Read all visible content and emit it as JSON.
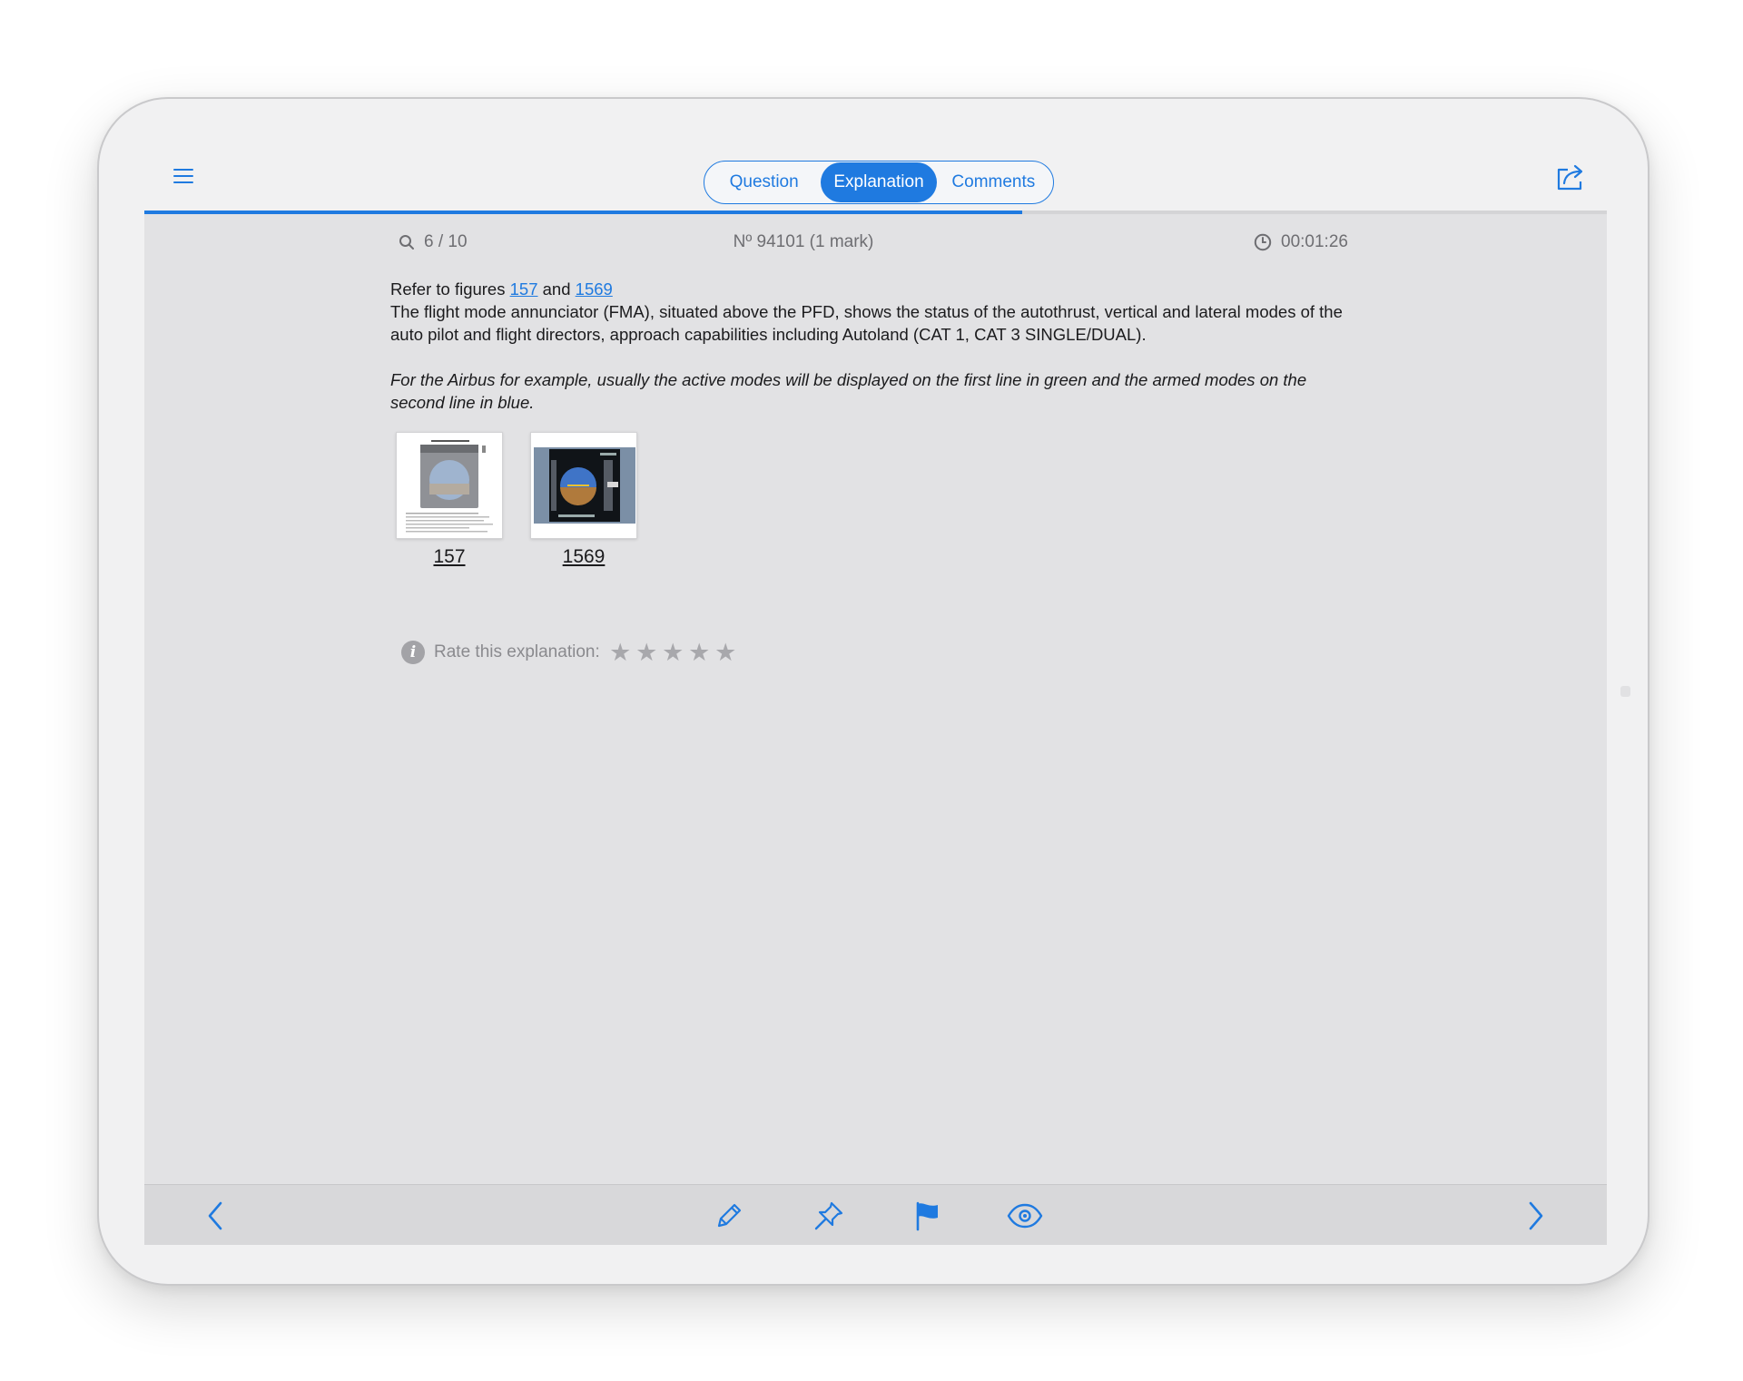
{
  "tabs": [
    {
      "label": "Question"
    },
    {
      "label": "Explanation",
      "active": true
    },
    {
      "label": "Comments"
    }
  ],
  "progress": {
    "fraction": 0.6
  },
  "meta": {
    "question_counter": "6 / 10",
    "question_number": "Nº 94101 (1 mark)",
    "timer": "00:01:26"
  },
  "explanation": {
    "refer_prefix": "Refer to figures ",
    "figure_link_1": "157",
    "refer_and": " and ",
    "figure_link_2": "1569",
    "body": "The flight mode annunciator (FMA), situated above the PFD, shows the status of the autothrust, vertical and lateral modes of the auto pilot and flight directors, approach capabilities including Autoland (CAT 1, CAT 3 SINGLE/DUAL).",
    "italic_note": "For the Airbus for example, usually the active modes will be displayed on the first line in green and the armed modes on the second line in blue."
  },
  "figures": [
    {
      "label": "157"
    },
    {
      "label": "1569"
    }
  ],
  "rating": {
    "label": "Rate this explanation:",
    "stars": [
      "★",
      "★",
      "★",
      "★",
      "★"
    ],
    "value": 0
  },
  "icons": {
    "menu": "menu-icon",
    "share": "share-icon",
    "search": "magnifier-icon",
    "clock": "clock-icon",
    "info": "info-icon",
    "info_glyph": "i",
    "prev": "chevron-left-icon",
    "edit": "pencil-icon",
    "pin": "pin-icon",
    "flag": "flag-icon",
    "show": "eye-icon",
    "next": "chevron-right-icon"
  },
  "colors": {
    "accent": "#1f7ae0",
    "screen_bg": "#e2e2e4",
    "bar_bg": "#f1f1f2",
    "star_inactive": "#a8a8ac"
  }
}
